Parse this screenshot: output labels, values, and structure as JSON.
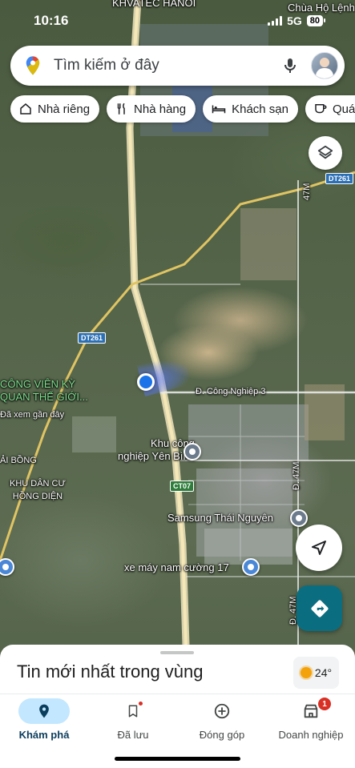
{
  "status_bar": {
    "time": "10:16",
    "network": "5G",
    "battery": "80"
  },
  "search": {
    "placeholder": "Tìm kiếm ở đây"
  },
  "chips": [
    {
      "label": "Nhà riêng",
      "icon": "home-icon"
    },
    {
      "label": "Nhà hàng",
      "icon": "restaurant-icon"
    },
    {
      "label": "Khách sạn",
      "icon": "hotel-icon"
    },
    {
      "label": "Quán",
      "icon": "cafe-icon"
    }
  ],
  "map": {
    "labels": {
      "top_area": "KHVATEC HANOI",
      "pagoda": "Chùa Hộ Lệnh",
      "park": "CÔNG VIÊN KỲ\nQUAN THẾ GIỚI...",
      "recently_viewed": "Đã xem gần đây",
      "bong": "ẢI BỒNG",
      "residential": "KHU DÂN CƯ\nHỒNG DIỆN",
      "street_industry": "Đ. Công Nghiệp 3",
      "industrial_park": "Khu công\nnghiệp Yên Bình",
      "samsung": "Samsung Thái Nguyên",
      "motorbike": "xe máy nam cường 17",
      "road_47m_top": "47M",
      "road_47m_mid": "Đ. 47M",
      "road_47m_low": "Đ. 47M"
    },
    "shields": {
      "dt261_top": "DT261",
      "dt261_left": "DT261",
      "ct07": "CT07"
    }
  },
  "sheet": {
    "title": "Tin mới nhất trong vùng",
    "temperature": "24°"
  },
  "nav": [
    {
      "label": "Khám phá",
      "icon": "explore-pin-icon",
      "active": true
    },
    {
      "label": "Đã lưu",
      "icon": "bookmark-icon",
      "active": false
    },
    {
      "label": "Đóng góp",
      "icon": "add-circle-icon",
      "active": false
    },
    {
      "label": "Doanh nghiệp",
      "icon": "store-icon",
      "active": false,
      "badge": "1"
    }
  ],
  "colors": {
    "accent": "#1a73e8",
    "directions": "#0b6e80",
    "nav_active_bg": "#c2e7ff",
    "badge": "#d93025"
  }
}
